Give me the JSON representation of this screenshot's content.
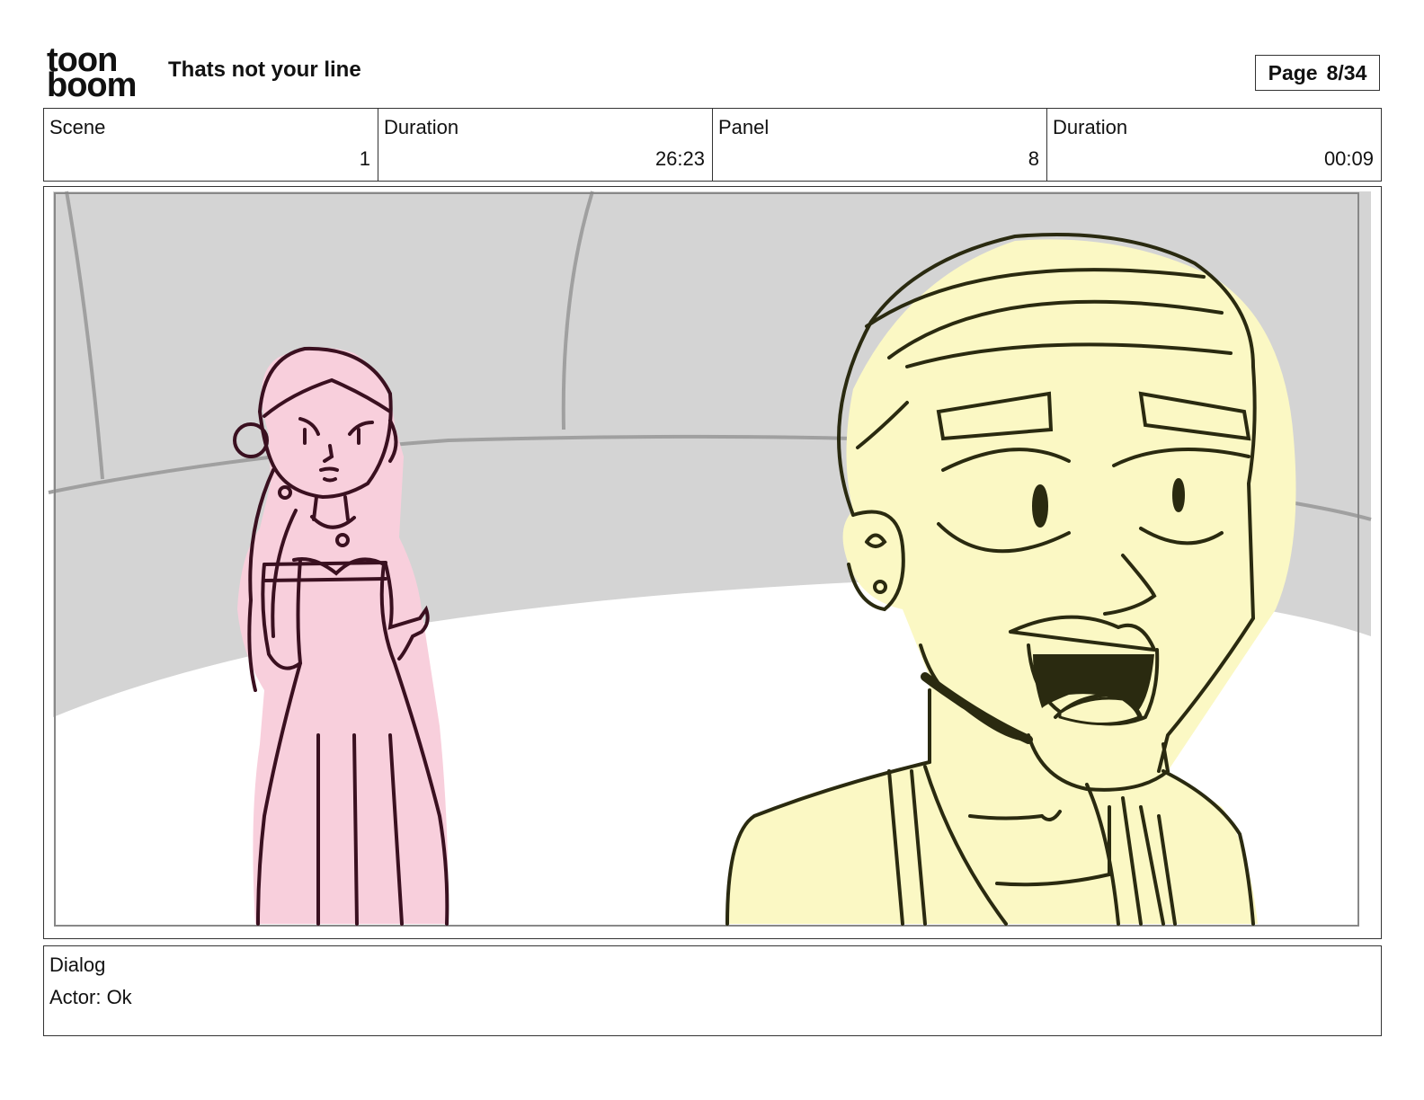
{
  "header": {
    "logo_text_top": "toon",
    "logo_text_bottom": "boom",
    "title": "Thats not your line",
    "page_label": "Page",
    "page_value": "8/34"
  },
  "info": {
    "scene_label": "Scene",
    "scene_value": "1",
    "duration_label": "Duration",
    "duration_value": "26:23",
    "panel_label": "Panel",
    "panel_value": "8",
    "panel_duration_label": "Duration",
    "panel_duration_value": "00:09"
  },
  "dialog": {
    "label": "Dialog",
    "text": "Actor: Ok"
  },
  "colors": {
    "wall": "#d4d4d4",
    "floor": "#ffffff",
    "girl_fill": "#f8cfdc",
    "girl_line": "#3a1020",
    "boy_fill": "#fbf8c4",
    "boy_line": "#2a2a10"
  }
}
